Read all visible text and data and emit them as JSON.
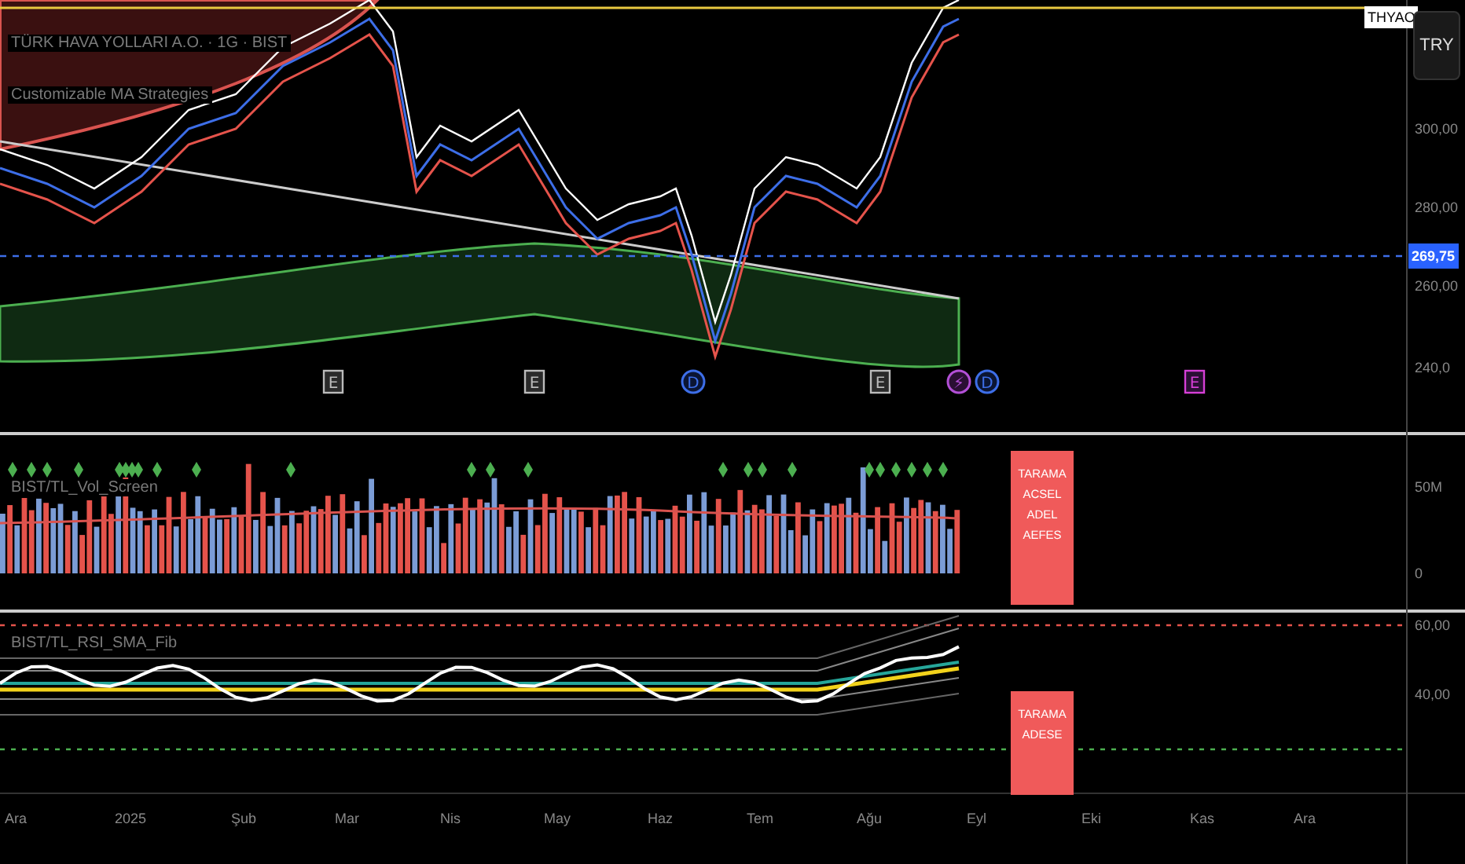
{
  "symbol_title": "TÜRK HAVA YOLLARI A.O. · 1G · BIST",
  "indicator_title": "Customizable MA Strategies",
  "symbol_tag": "THYAO",
  "currency_button": "TRY",
  "price_axis": [
    "300,00",
    "280,00",
    "260,00",
    "240,0"
  ],
  "last_price": "269,75",
  "event_markers": [
    {
      "label": "E",
      "kind": "earnings"
    },
    {
      "label": "E",
      "kind": "earnings"
    },
    {
      "label": "D",
      "kind": "dividend"
    },
    {
      "label": "E",
      "kind": "earnings"
    },
    {
      "label": "⚡",
      "kind": "split"
    },
    {
      "label": "D",
      "kind": "dividend"
    },
    {
      "label": "E",
      "kind": "upcoming"
    }
  ],
  "volume_pane": {
    "title": "BIST/TL_Vol_Screen",
    "axis": [
      "50M",
      "0"
    ],
    "scan_label": [
      "TARAMA",
      "ACSEL",
      "ADEL",
      "AEFES"
    ]
  },
  "rsi_pane": {
    "title": "BIST/TL_RSI_SMA_Fib",
    "axis": [
      "60,00",
      "40,00"
    ],
    "scan_label": [
      "TARAMA",
      "ADESE"
    ]
  },
  "time_axis": [
    "Ara",
    "2025",
    "Şub",
    "Mar",
    "Nis",
    "May",
    "Haz",
    "Tem",
    "Ağu",
    "Eyl",
    "Eki",
    "Kas",
    "Ara"
  ]
}
